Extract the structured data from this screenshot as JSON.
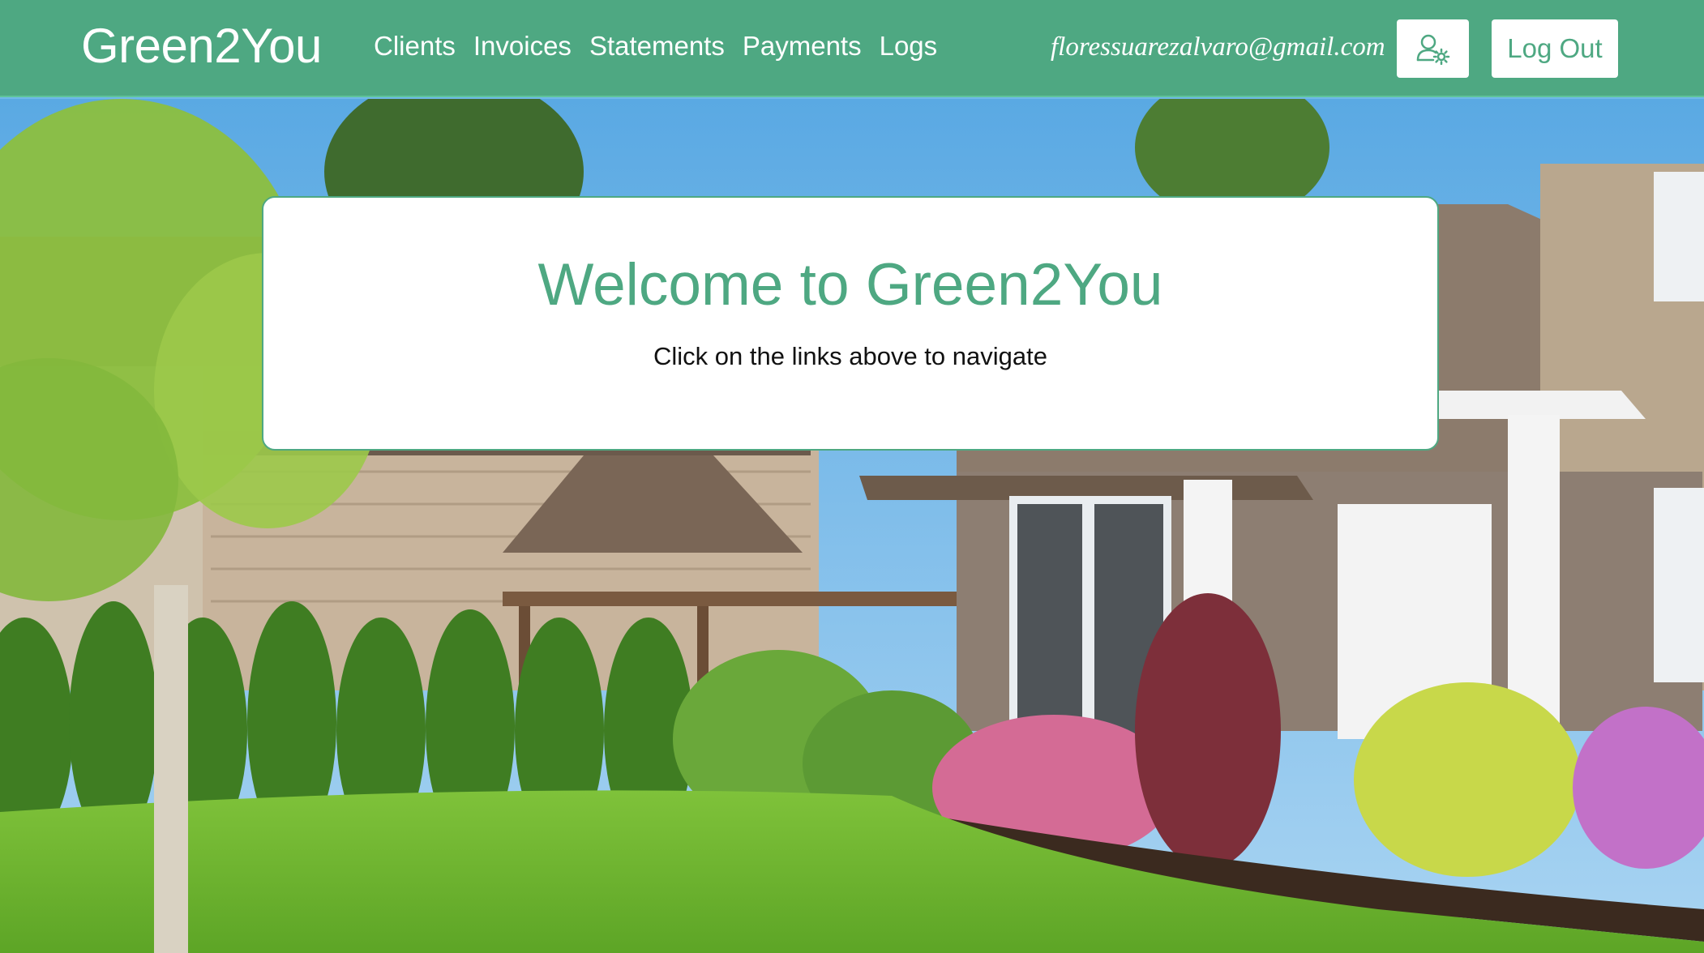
{
  "navbar": {
    "brand": "Green2You",
    "links": [
      {
        "label": "Clients"
      },
      {
        "label": "Invoices"
      },
      {
        "label": "Statements"
      },
      {
        "label": "Payments"
      },
      {
        "label": "Logs"
      }
    ],
    "user_email": "floressuarezalvaro@gmail.com",
    "settings_icon": "user-settings-icon",
    "logout_label": "Log Out"
  },
  "hero": {
    "background": "photo of a suburban house with a green lawn and shrubs"
  },
  "welcome": {
    "title": "Welcome to Green2You",
    "subtitle": "Click on the links above to navigate"
  },
  "colors": {
    "brand_green": "#4ea882",
    "white": "#ffffff"
  }
}
